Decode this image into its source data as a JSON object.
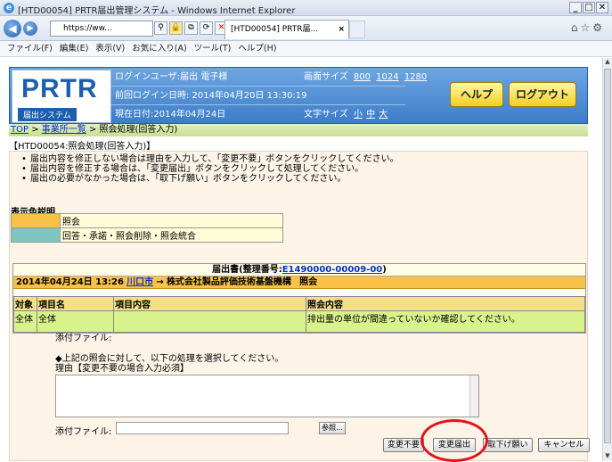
{
  "window": {
    "title": "[HTD00054] PRTR届出管理システム - Windows Internet Explorer",
    "address": "https://ww...",
    "tab": "[HTD00054] PRTR届..."
  },
  "menu": [
    "ファイル(F)",
    "編集(E)",
    "表示(V)",
    "お気に入り(A)",
    "ツール(T)",
    "ヘルプ(H)"
  ],
  "header": {
    "logo_big": "PRTR",
    "logo_small": "届出システム",
    "login_user": "ログインユーザ:届出 電子様",
    "last_login": "前回ログイン日時: 2014年04月20日 13:30:19",
    "current_date": "現在日付:2014年04月24日",
    "screen_size_label": "画面サイズ",
    "screen_sizes": [
      "800",
      "1024",
      "1280"
    ],
    "font_size_label": "文字サイズ",
    "font_sizes": [
      "小",
      "中",
      "大"
    ],
    "help_button": "ヘルプ",
    "logout_button": "ログアウト"
  },
  "breadcrumb": {
    "top": "TOP",
    "sep1": " > ",
    "office_list": "事業所一覧",
    "sep2": " > ",
    "current": "照会処理(回答入力)"
  },
  "page_id": "【HTD00054:照会処理(回答入力)】",
  "notices": [
    "届出内容を修正しない場合は理由を入力して、「変更不要」ボタンをクリックしてください。",
    "届出内容を修正する場合は、「変更届出」ボタンをクリックして処理してください。",
    "届出の必要がなかった場合は、「取下げ願い」ボタンをクリックしてください。"
  ],
  "legend": {
    "title": "表示色説明",
    "items": [
      {
        "label": "照会",
        "color": "#f7c247"
      },
      {
        "label": "回答・承諾・照会削除・照会統合",
        "color": "#7fc6c2"
      }
    ]
  },
  "response": {
    "header_label": "届出書(整理番号:",
    "serial_number": "E1490000-00009-00",
    "header_close": ")",
    "bar_date": "2014年04月24日 13:26",
    "bar_from": "川口市",
    "bar_arrow": "→",
    "bar_to": "株式会社製品評価技術基盤機構",
    "bar_type": "照会",
    "columns": [
      "対象",
      "項目名",
      "項目内容",
      "照会内容"
    ],
    "rows": [
      {
        "target": "全体",
        "item": "全体",
        "content": "",
        "comment": "排出量の単位が間違っていないか確認してください。"
      }
    ]
  },
  "attachment_label": "添付ファイル:",
  "instruction_line1": "◆上記の照会に対して、以下の処理を選択してください。",
  "instruction_line2": "理由【変更不要の場合入力必須】",
  "file_label": "添付ファイル:",
  "browse_button": "参照...",
  "actions": {
    "no_change": "変更不要",
    "change": "変更届出",
    "withdraw": "取下げ願い",
    "cancel": "キャンセル"
  },
  "colors": {
    "header_blue": "#3d7dc9",
    "inquiry_orange": "#f7c247",
    "reply_teal": "#7fc6c2",
    "highlight_red": "#e0141e"
  }
}
